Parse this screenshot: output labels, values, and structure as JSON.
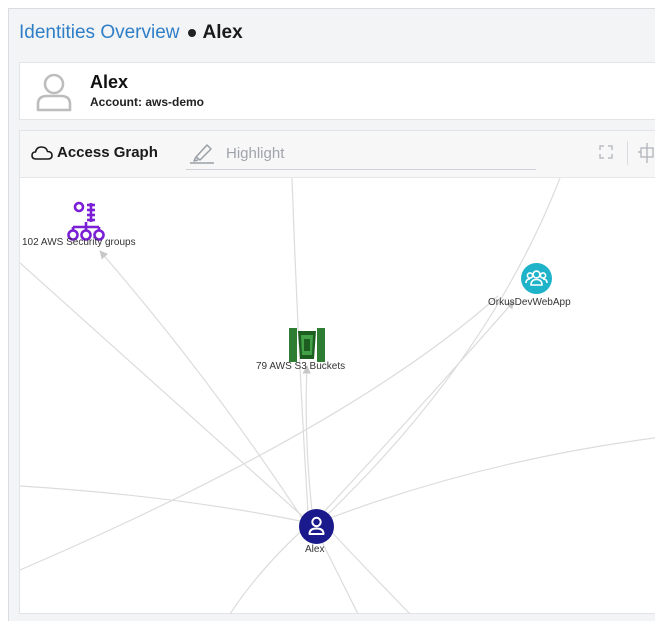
{
  "breadcrumb": {
    "parent": "Identities Overview",
    "current": "Alex"
  },
  "identity": {
    "name": "Alex",
    "account": "Account: aws-demo"
  },
  "graph_panel": {
    "tab_label": "Access Graph",
    "highlight_placeholder": "Highlight"
  },
  "graph": {
    "nodes": [
      {
        "id": "security-groups",
        "label": "102 AWS Security groups",
        "type": "security-group",
        "color": "#7b1fd6"
      },
      {
        "id": "s3-buckets",
        "label": "79 AWS S3 Buckets",
        "type": "s3-bucket",
        "color": "#2e7d32"
      },
      {
        "id": "webapp",
        "label": "OrkusDevWebApp",
        "type": "user-group",
        "color": "#1fb3c9"
      },
      {
        "id": "alex",
        "label": "Alex",
        "type": "user",
        "color": "#1a1a8c"
      }
    ]
  },
  "colors": {
    "link": "#2f7fc7",
    "edge": "#d4d4d4"
  }
}
